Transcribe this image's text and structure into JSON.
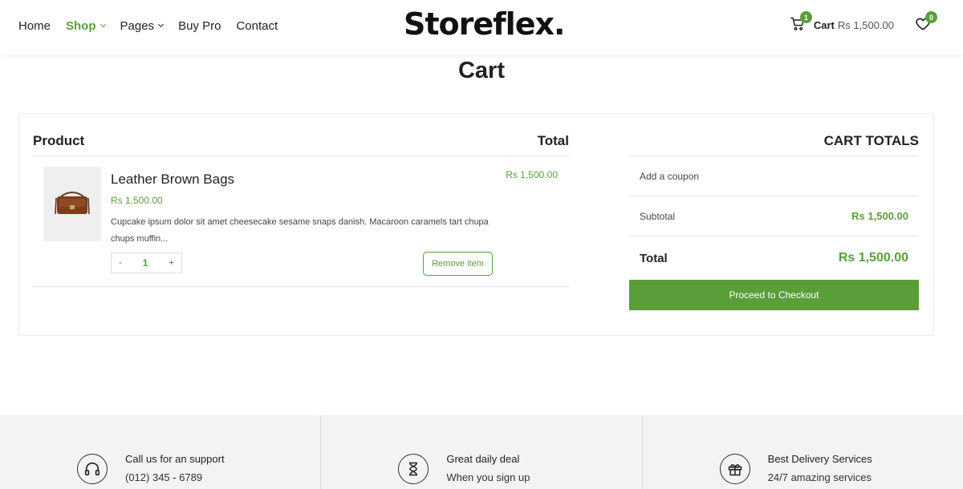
{
  "nav": {
    "items": [
      {
        "label": "Home",
        "active": false,
        "has_dropdown": false
      },
      {
        "label": "Shop",
        "active": true,
        "has_dropdown": true
      },
      {
        "label": "Pages",
        "active": false,
        "has_dropdown": true
      },
      {
        "label": "Buy Pro",
        "active": false,
        "has_dropdown": false
      },
      {
        "label": "Contact",
        "active": false,
        "has_dropdown": false
      }
    ]
  },
  "logo": "Storeflex.",
  "header_right": {
    "cart_icon": "shopping-cart-icon",
    "cart_count": "1",
    "cart_label": "Cart",
    "cart_amount": "Rs 1,500.00",
    "wishlist_icon": "heart-icon",
    "wishlist_count": "0"
  },
  "page_title": "Cart",
  "cart_table": {
    "col_product": "Product",
    "col_total": "Total",
    "items": [
      {
        "name": "Leather Brown Bags",
        "price": "Rs 1,500.00",
        "description": "Cupcake ipsum dolor sit amet cheesecake sesame snaps danish. Macaroon caramels tart chupa chups muffin...",
        "qty_minus": "-",
        "qty": "1",
        "qty_plus": "+",
        "remove_label": "Remove item",
        "total": "Rs 1,500.00"
      }
    ]
  },
  "cart_totals": {
    "heading": "CART TOTALS",
    "coupon_label": "Add a coupon",
    "subtotal_label": "Subtotal",
    "subtotal_value": "Rs 1,500.00",
    "total_label": "Total",
    "total_value": "Rs 1,500.00",
    "checkout_label": "Proceed to Checkout"
  },
  "features": [
    {
      "icon": "headphones-icon",
      "title": "Call us for an support",
      "subtitle": "(012) 345 - 6789"
    },
    {
      "icon": "hourglass-icon",
      "title": "Great daily deal",
      "subtitle": "When you sign up"
    },
    {
      "icon": "gift-icon",
      "title": "Best Delivery Services",
      "subtitle": "24/7 amazing services"
    }
  ],
  "colors": {
    "accent": "#5a9e3a",
    "footer_bg": "#f3f3f3"
  }
}
